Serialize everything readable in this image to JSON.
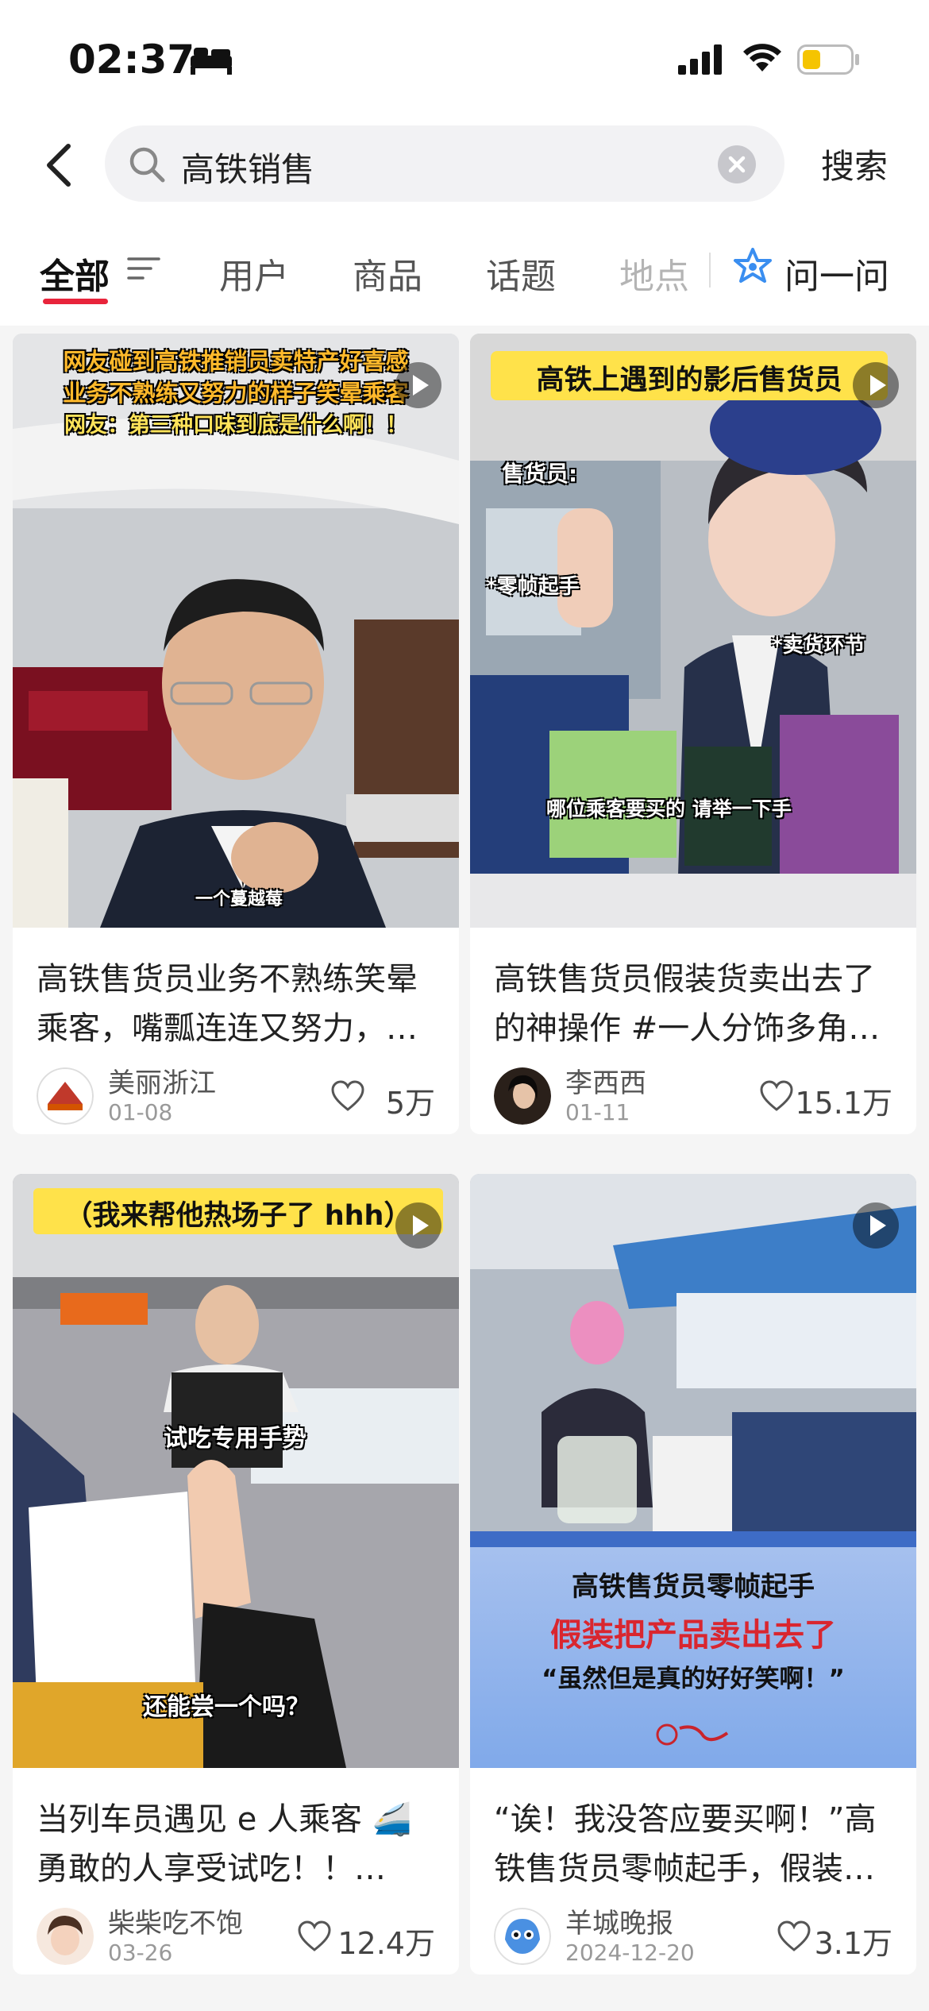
{
  "status_bar": {
    "time": "02:37",
    "icons": [
      "bed-icon",
      "signal-icon",
      "wifi-icon",
      "battery-icon"
    ],
    "battery_level": 0.3
  },
  "search": {
    "query": "高铁销售",
    "submit_label": "搜索"
  },
  "tabs": {
    "items": [
      "全部",
      "用户",
      "商品",
      "话题",
      "地点"
    ],
    "active": "全部",
    "ask_label": "问一问"
  },
  "colors": {
    "accent": "#e8243b",
    "text_primary": "#222222",
    "text_secondary": "#999999"
  },
  "cards": [
    {
      "overlay": [
        "网友碰到高铁推销员卖特产好喜感",
        "业务不熟练又努力的样子笑晕乘客",
        "网友：第三种口味到底是什么啊！！"
      ],
      "caption": "一个蔓越莓",
      "title": "高铁售货员业务不熟练笑晕乘客，嘴瓢连连又努力，…",
      "author": "美丽浙江",
      "date": "01-08",
      "likes": "5万"
    },
    {
      "overlay": [
        "高铁上遇到的影后售货员"
      ],
      "stickers": [
        "售货员:",
        "*零帧起手",
        "*卖货环节",
        "哪位乘客要买的 请举一下手"
      ],
      "title": "高铁售货员假装货卖出去了的神操作 #一人分饰多角…",
      "author": "李西西",
      "date": "01-11",
      "likes": "15.1万"
    },
    {
      "overlay": [
        "（我来帮他热场子了 hhh）"
      ],
      "stickers": [
        "试吃专用手势",
        "还能尝一个吗？"
      ],
      "title": "当列车员遇见 e 人乘客 🚄 勇敢的人享受试吃！！…",
      "author": "柴柴吃不饱",
      "date": "03-26",
      "likes": "12.4万"
    },
    {
      "overlay": [
        "高铁售货员零帧起手",
        "假装把产品卖出去了",
        "“虽然但是真的好好笑啊！”"
      ],
      "title": "“诶！我没答应要买啊！”高铁售货员零帧起手，假装…",
      "author": "羊城晚报",
      "date": "2024-12-20",
      "likes": "3.1万"
    }
  ]
}
